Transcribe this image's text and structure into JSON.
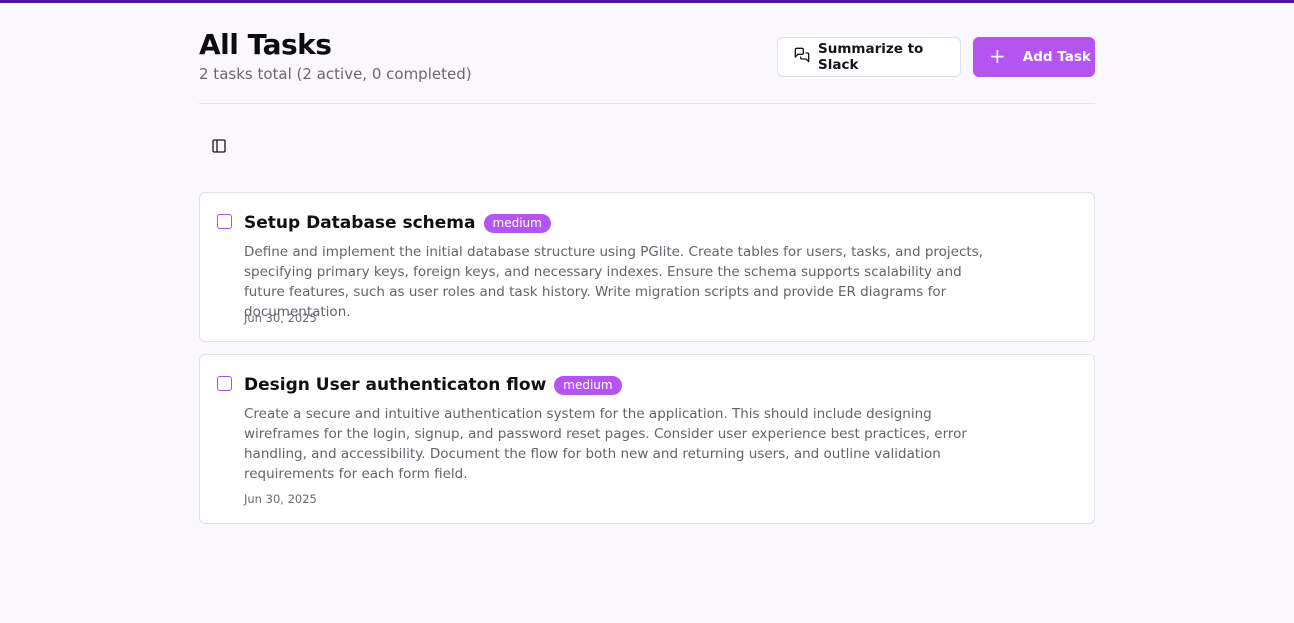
{
  "header": {
    "title": "All Tasks",
    "subtitle": "2 tasks total (2 active, 0 completed)",
    "summarize_label": "Summarize to Slack",
    "add_label": "Add Task"
  },
  "icons": {
    "summarize": "message-square-icon",
    "add": "plus-icon",
    "sidebar_toggle": "panel-left-icon"
  },
  "colors": {
    "accent": "#b654f1",
    "top_bar": "#4a12a8",
    "background": "#faf7fd"
  },
  "tasks": [
    {
      "title": "Setup Database schema",
      "priority": "medium",
      "description": "Define and implement the initial database structure using PGlite. Create tables for users, tasks, and projects, specifying primary keys, foreign keys, and necessary indexes. Ensure the schema supports scalability and future features, such as user roles and task history. Write migration scripts and provide ER diagrams for documentation.",
      "date": "Jun 30, 2025",
      "completed": false
    },
    {
      "title": "Design User authenticaton flow",
      "priority": "medium",
      "description": "Create a secure and intuitive authentication system for the application. This should include designing wireframes for the login, signup, and password reset pages. Consider user experience best practices, error handling, and accessibility. Document the flow for both new and returning users, and outline validation requirements for each form field.",
      "date": "Jun 30, 2025",
      "completed": false
    }
  ]
}
